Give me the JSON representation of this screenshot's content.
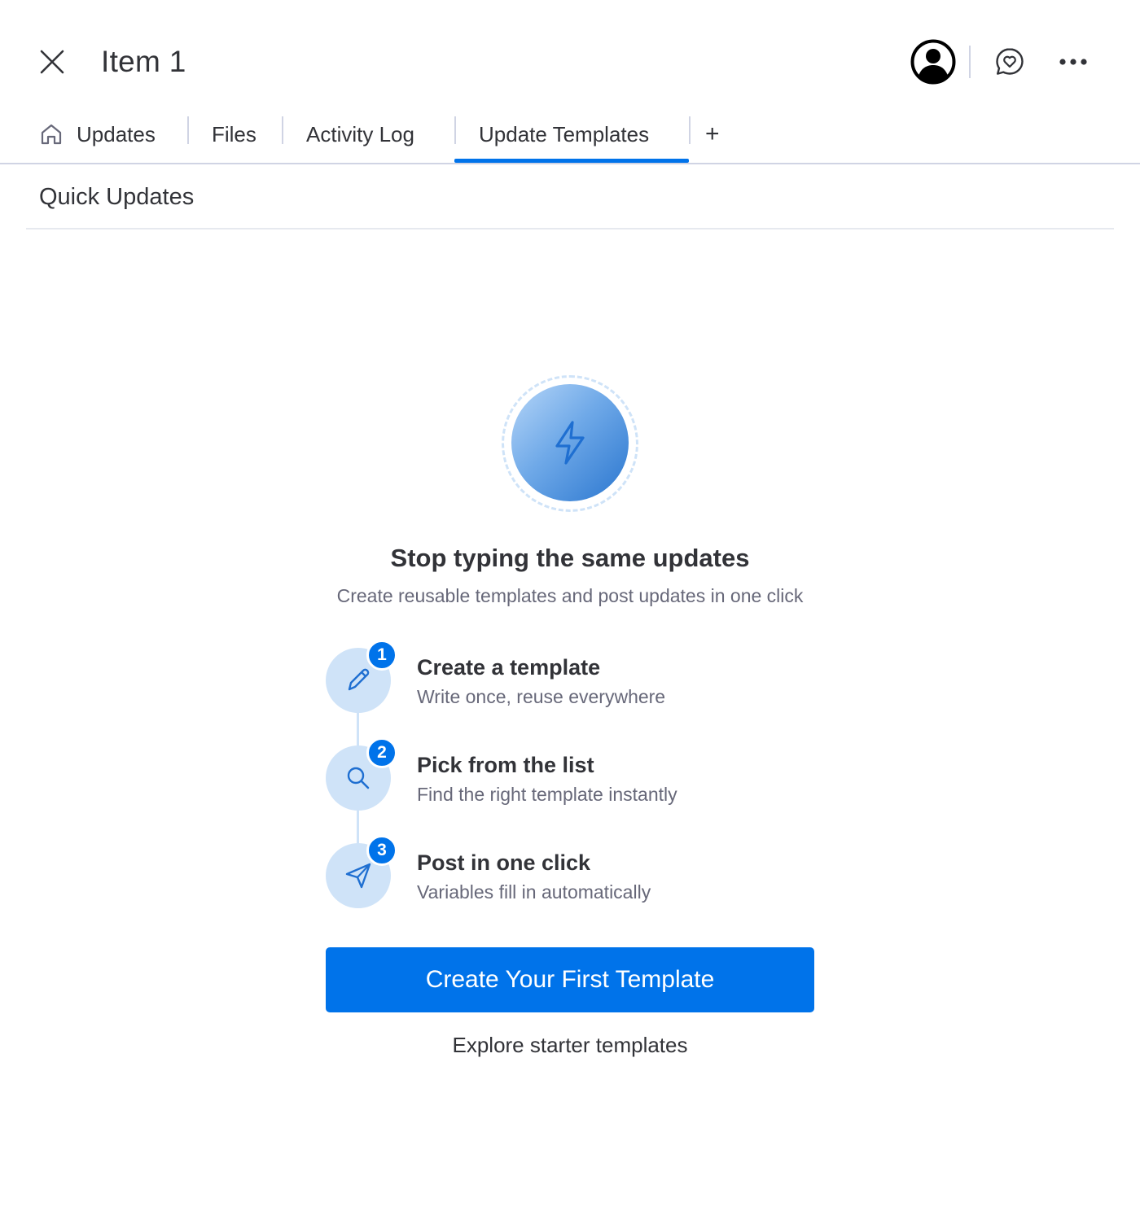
{
  "header": {
    "title": "Item 1",
    "icons": [
      "close-icon",
      "user-avatar-icon",
      "chat-heart-icon",
      "more-horizontal-icon"
    ]
  },
  "tabs": [
    {
      "label": "Updates",
      "icon": "home-icon",
      "active": false
    },
    {
      "label": "Files",
      "active": false
    },
    {
      "label": "Activity Log",
      "active": false
    },
    {
      "label": "Update Templates",
      "active": true
    },
    {
      "label": "+",
      "icon": "add-tab-icon"
    }
  ],
  "section": {
    "title": "Quick Updates"
  },
  "hero": {
    "icon": "lightning-icon",
    "headline": "Stop typing the same updates",
    "subline": "Create reusable templates and post updates in one click"
  },
  "steps": [
    {
      "number": "1",
      "icon": "pencil-icon",
      "title": "Create a template",
      "desc": "Write once, reuse everywhere"
    },
    {
      "number": "2",
      "icon": "search-icon",
      "title": "Pick from the list",
      "desc": "Find the right template instantly"
    },
    {
      "number": "3",
      "icon": "send-icon",
      "title": "Post in one click",
      "desc": "Variables fill in automatically"
    }
  ],
  "cta": {
    "primary_label": "Create Your First Template",
    "secondary_label": "Explore starter templates"
  },
  "colors": {
    "accent": "#0073ea",
    "step_bg": "#cfe3f8",
    "text_primary": "#323338",
    "text_secondary": "#676879",
    "divider": "#d0d4e4"
  }
}
